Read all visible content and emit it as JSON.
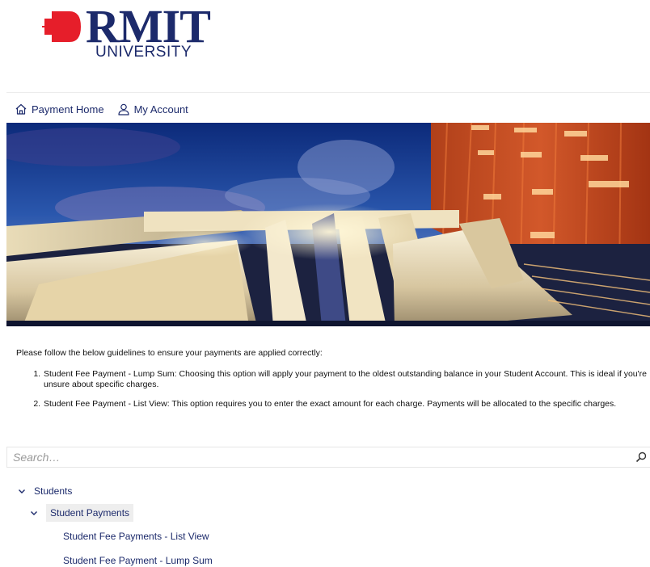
{
  "brand": {
    "wordmark": "RMIT",
    "subtitle": "UNIVERSITY",
    "accent_red": "#e61e2a",
    "navy": "#1c2a6b"
  },
  "nav": {
    "items": [
      {
        "label": "Payment Home",
        "icon": "home-icon"
      },
      {
        "label": "My Account",
        "icon": "user-icon"
      }
    ]
  },
  "hero": {
    "icon": "building-facade-photo"
  },
  "guidelines": {
    "intro": "Please follow the below guidelines to ensure your payments are applied correctly:",
    "items": [
      "Student Fee Payment - Lump Sum: Choosing this option will apply your payment to the oldest outstanding balance in your Student Account. This is ideal if you're unsure about specific charges.",
      "Student Fee Payment - List View: This option requires you to enter the exact amount for each charge. Payments will be allocated to the specific charges."
    ]
  },
  "search": {
    "placeholder": "Search…",
    "icon": "search-icon"
  },
  "tree": {
    "root": "Students",
    "group": "Student Payments",
    "items": [
      "Student Fee Payments - List View",
      "Student Fee Payment - Lump Sum"
    ]
  }
}
